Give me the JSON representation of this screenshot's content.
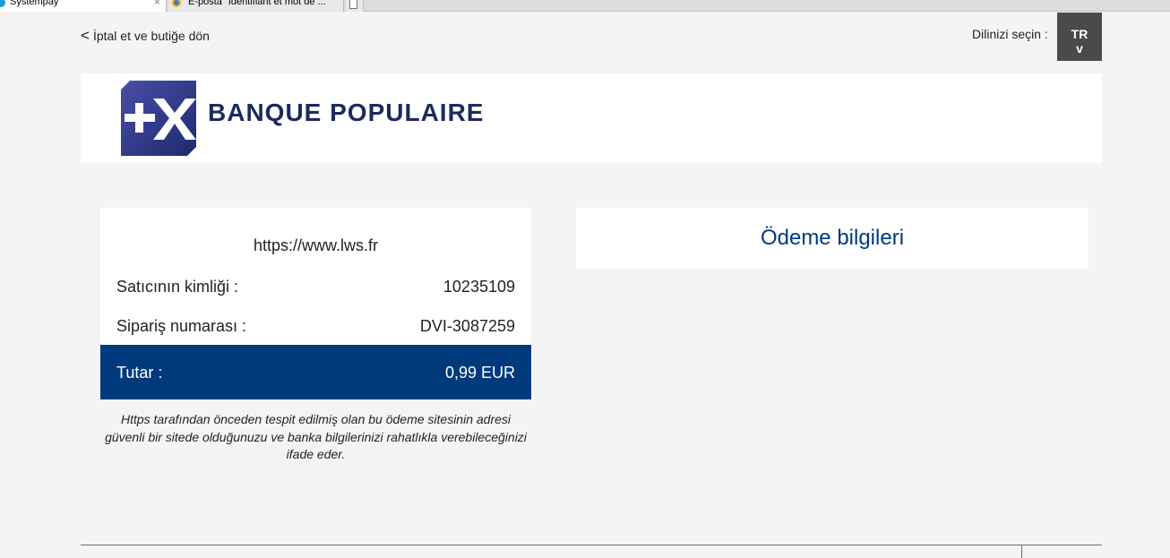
{
  "browser": {
    "tabs": [
      {
        "title": "Systempay",
        "active": true
      },
      {
        "title": "E-posta \"Identifiant et mot de ..."
      }
    ],
    "close_glyph": "×"
  },
  "header": {
    "back_chevron": "<",
    "back_label": "İptal et ve butiğe dön",
    "language_label": "Dilinizi seçin :",
    "language_code": "TR",
    "language_chevron": "v"
  },
  "brand": {
    "logo_icon": "banque-populaire-logo-icon",
    "name": "BANQUE POPULAIRE",
    "color": "#1d2a5e"
  },
  "summary": {
    "shop_url": "https://www.lws.fr",
    "merchant_id_label": "Satıcının kimliği :",
    "merchant_id_value": "10235109",
    "order_number_label": "Sipariş numarası :",
    "order_number_value": "DVI-3087259",
    "amount_label": "Tutar :",
    "amount_value": "0,99 EUR",
    "accent_color": "#003a7d"
  },
  "security_note": "Https tarafından önceden tespit edilmiş olan bu ödeme sitesinin adresi güvenli bir sitede olduğunuzu ve banka bilgilerinizi rahatlıkla verebileceğinizi ifade eder.",
  "payment": {
    "title": "Ödeme bilgileri"
  }
}
